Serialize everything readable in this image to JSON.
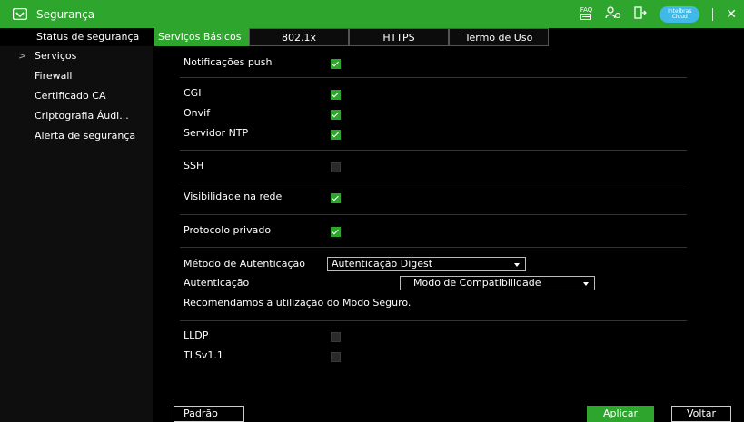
{
  "window": {
    "title": "Segurança"
  },
  "topbar": {
    "faq_label": "FAQ",
    "cloud_label": "Intelbras Cloud"
  },
  "tabs": [
    {
      "label": "Status de segurança"
    },
    {
      "label": "Serviços Básicos"
    },
    {
      "label": "802.1x"
    },
    {
      "label": "HTTPS"
    },
    {
      "label": "Termo de Uso"
    }
  ],
  "sidebar": {
    "items": [
      {
        "label": "Serviços",
        "arrow": ">"
      },
      {
        "label": "Firewall"
      },
      {
        "label": "Certificado CA"
      },
      {
        "label": "Criptografia Áudi..."
      },
      {
        "label": "Alerta de segurança"
      }
    ]
  },
  "settings": {
    "push": {
      "label": "Notificações push",
      "checked": true
    },
    "cgi": {
      "label": "CGI",
      "checked": true
    },
    "onvif": {
      "label": "Onvif",
      "checked": true
    },
    "ntp": {
      "label": "Servidor NTP",
      "checked": true
    },
    "ssh": {
      "label": "SSH",
      "checked": false
    },
    "visibility": {
      "label": "Visibilidade na rede",
      "checked": true
    },
    "private_protocol": {
      "label": "Protocolo privado",
      "checked": true
    },
    "auth_method": {
      "label": "Método de Autenticação",
      "value": "Autenticação Digest"
    },
    "auth": {
      "label": "Autenticação",
      "value": "Modo de Compatibilidade"
    },
    "recommendation": "Recomendamos a utilização do Modo Seguro.",
    "lldp": {
      "label": "LLDP",
      "checked": false
    },
    "tls": {
      "label": "TLSv1.1",
      "checked": false
    }
  },
  "buttons": {
    "default": "Padrão",
    "apply": "Aplicar",
    "back": "Voltar"
  },
  "colors": {
    "accent": "#2ea62e",
    "background": "#000000",
    "sidebar": "#0e0e0e"
  }
}
